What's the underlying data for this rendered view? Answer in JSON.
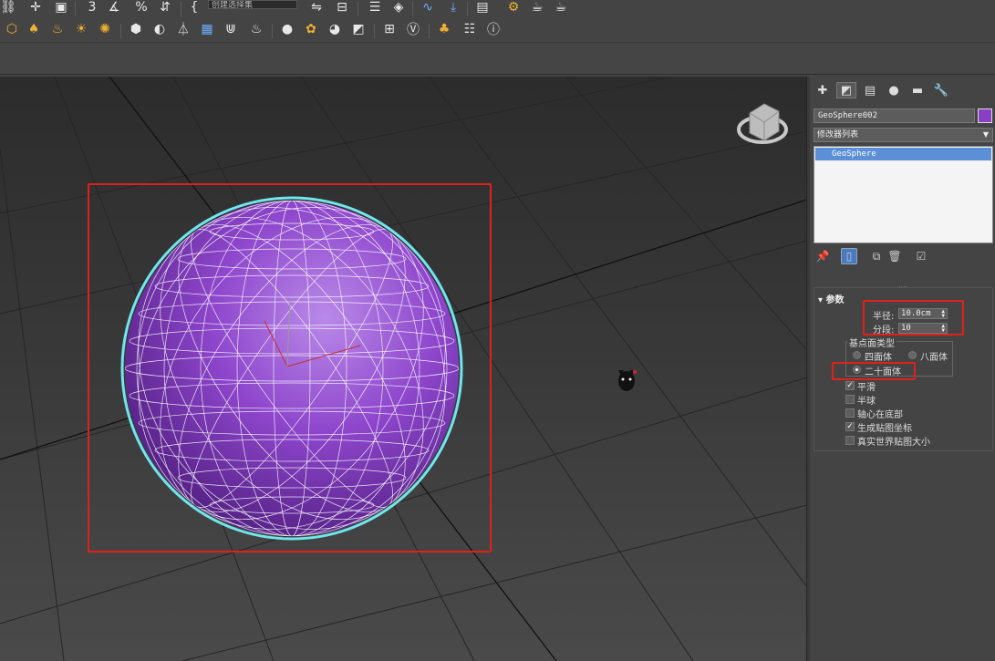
{
  "toolbar": {
    "selection_set_placeholder": "创建选择集",
    "snap_label": "3",
    "percent_label": "%"
  },
  "icons_row1": [
    "link-icon",
    "move-icon",
    "select-icon",
    "snap-icon",
    "angle-snap-icon",
    "percent-snap-icon",
    "spinner-snap-icon",
    "named-selection-icon",
    "mirror-icon",
    "align-icon",
    "layer-explorer-icon",
    "layers-icon",
    "curve-editor-icon",
    "material-editor-icon",
    "render-setup-icon",
    "render-frame-icon",
    "render-icon"
  ],
  "icons_row2": [
    "geometry-icon",
    "light-cone-icon",
    "light-icon",
    "sun-icon",
    "sparkle-icon",
    "box-icon",
    "daylight-icon",
    "tripod-icon",
    "grid-icon",
    "grass-icon",
    "fire-icon",
    "sphere-icon",
    "particles-icon",
    "palette-icon",
    "render-icon",
    "slate-icon",
    "v-ray-icon",
    "tree-icon",
    "list-icon",
    "help-icon"
  ],
  "panel": {
    "tabs": [
      "create-tab",
      "modify-tab",
      "hierarchy-tab",
      "motion-tab",
      "display-tab",
      "utilities-tab"
    ],
    "object_name": "GeoSphere002",
    "object_color": "#8a3fc4",
    "modifier_list": "修改器列表",
    "stack_item": "GeoSphere",
    "rollout_title": "参数",
    "radius_label": "半径:",
    "radius_value": "10.0cm",
    "segments_label": "分段:",
    "segments_value": "10",
    "base_type_label": "基点面类型",
    "tetra_label": "四面体",
    "octa_label": "八面体",
    "icosa_label": "二十面体",
    "selected_base_type": "二十面体",
    "smooth_label": "平滑",
    "smooth_checked": true,
    "hemisphere_label": "半球",
    "hemisphere_checked": false,
    "base_pivot_label": "轴心在底部",
    "base_pivot_checked": false,
    "gen_map_label": "生成贴图坐标",
    "gen_map_checked": true,
    "real_world_label": "真实世界贴图大小",
    "real_world_checked": false
  },
  "colors": {
    "sphere": "#8a3fc4",
    "selection_outline": "#6fe6ee",
    "annotation_red": "#e0201a",
    "active_blue": "#5b8fd6"
  }
}
